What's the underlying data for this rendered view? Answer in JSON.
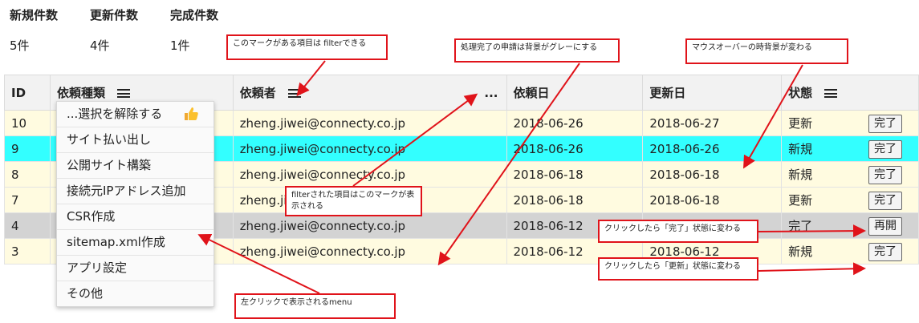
{
  "stats": [
    {
      "label": "新規件数",
      "value": "5件"
    },
    {
      "label": "更新件数",
      "value": "4件"
    },
    {
      "label": "完成件数",
      "value": "1件"
    }
  ],
  "table": {
    "columns": {
      "id": "ID",
      "type": "依頼種類",
      "requester": "依頼者",
      "requester_more": "...",
      "request_date": "依頼日",
      "updated_date": "更新日",
      "status": "状態"
    },
    "rows": [
      {
        "id": "10",
        "requester": "zheng.jiwei@connecty.co.jp",
        "request_date": "2018-06-26",
        "updated_date": "2018-06-27",
        "status": "更新",
        "action": "完了"
      },
      {
        "id": "9",
        "requester": "zheng.jiwei@connecty.co.jp",
        "request_date": "2018-06-26",
        "updated_date": "2018-06-26",
        "status": "新規",
        "action": "完了"
      },
      {
        "id": "8",
        "requester": "zheng.jiwei@connecty.co.jp",
        "request_date": "2018-06-18",
        "updated_date": "2018-06-18",
        "status": "新規",
        "action": "完了"
      },
      {
        "id": "7",
        "requester": "zheng.jiwei@connecty.co.jp",
        "request_date": "2018-06-18",
        "updated_date": "2018-06-18",
        "status": "更新",
        "action": "完了"
      },
      {
        "id": "4",
        "requester": "zheng.jiwei@connecty.co.jp",
        "request_date": "2018-06-12",
        "updated_date": "2018-06-12",
        "status": "完了",
        "action": "再開"
      },
      {
        "id": "3",
        "requester": "zheng.jiwei@connecty.co.jp",
        "request_date": "2018-06-12",
        "updated_date": "2018-06-12",
        "status": "新規",
        "action": "完了"
      }
    ]
  },
  "filter_menu": {
    "items": [
      "...選択を解除する",
      "サイト払い出し",
      "公開サイト構築",
      "接続元IPアドレス追加",
      "CSR作成",
      "sitemap.xml作成",
      "アプリ設定",
      "その他"
    ]
  },
  "annotations": {
    "filter_mark": "このマークがある項目は filterできる",
    "grey_bg": "処理完了の申請は背景がグレーにする",
    "hover_bg": "マウスオーバーの時背景が変わる",
    "filtered_mark": "filterされた項目はこのマークが表示される",
    "click_to_done": "クリックしたら「完了」状態に変わる",
    "click_to_update": "クリックしたら「更新」状態に変わる",
    "left_click_menu": "左クリックで表示されるmenu"
  },
  "colors": {
    "row_default": "#fffbe0",
    "row_hover": "#33ffff",
    "row_done": "#d3d3d3",
    "annotation_red": "#e0131a"
  }
}
